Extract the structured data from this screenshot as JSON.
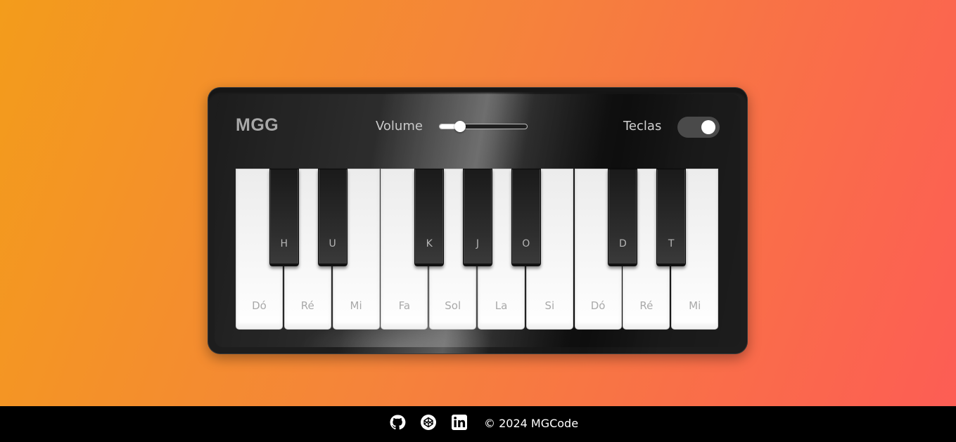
{
  "piano": {
    "logo": "MGG",
    "volume": {
      "label": "Volume",
      "value": 0.23
    },
    "keys_toggle": {
      "label": "Teclas",
      "on": true
    },
    "white_keys": [
      {
        "note": "Dó"
      },
      {
        "note": "Ré"
      },
      {
        "note": "Mi"
      },
      {
        "note": "Fa"
      },
      {
        "note": "Sol"
      },
      {
        "note": "La"
      },
      {
        "note": "Si"
      },
      {
        "note": "Dó"
      },
      {
        "note": "Ré"
      },
      {
        "note": "Mi"
      }
    ],
    "black_keys": [
      {
        "key": "H"
      },
      {
        "key": "U"
      },
      {
        "key": "K"
      },
      {
        "key": "J"
      },
      {
        "key": "O"
      },
      {
        "key": "D"
      },
      {
        "key": "T"
      }
    ]
  },
  "footer": {
    "icons": [
      "github-icon",
      "codepen-icon",
      "linkedin-icon"
    ],
    "copyright": "© 2024 MGCode"
  },
  "colors": {
    "background_start": "#f39c1b",
    "background_end": "#fd5c55",
    "piano_body": "#1d1d1d",
    "footer": "#000000"
  }
}
